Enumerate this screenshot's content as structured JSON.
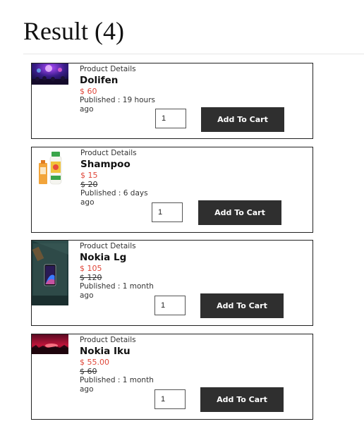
{
  "page": {
    "title": "Result (4)"
  },
  "products": [
    {
      "label": "Product Details",
      "name": "Dolifen",
      "price": "$ 60",
      "old_price": "",
      "published": "Published : 19 hours ago",
      "quantity": "1",
      "button_label": "Add To Cart",
      "image_icon": "concert-lights-photo"
    },
    {
      "label": "Product Details",
      "name": "Shampoo",
      "price": "$ 15",
      "old_price": "$ 20",
      "published": "Published : 6 days ago",
      "quantity": "1",
      "button_label": "Add To Cart",
      "image_icon": "shampoo-bottles-photo"
    },
    {
      "label": "Product Details",
      "name": "Nokia Lg",
      "price": "$ 105",
      "old_price": "$ 120",
      "published": "Published : 1 month ago",
      "quantity": "1",
      "button_label": "Add To Cart",
      "image_icon": "smartphone-photo"
    },
    {
      "label": "Product Details",
      "name": "Nokia Iku",
      "price": "$ 55.00",
      "old_price": "$ 60",
      "published": "Published : 1 month ago",
      "quantity": "1",
      "button_label": "Add To Cart",
      "image_icon": "sunset-photo"
    }
  ],
  "colors": {
    "price": "#e0473a",
    "button": "#2f2f2f"
  }
}
